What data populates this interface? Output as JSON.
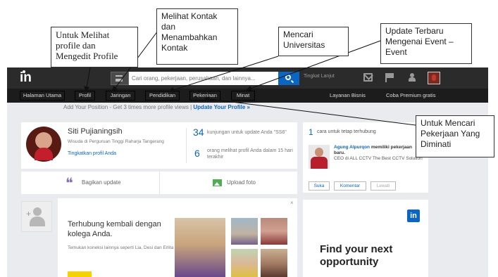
{
  "topbar": {
    "logo": "in",
    "search_placeholder": "Cari orang, pekerjaan, perusahaan, dan lainnya...",
    "advanced_link": "Tingkat Lanjut",
    "icons": [
      "search-icon",
      "mail-icon",
      "flag-icon",
      "add-connection-icon",
      "avatar"
    ]
  },
  "nav": {
    "items": [
      "Halaman Utama",
      "Profil",
      "Jaringan",
      "Pendidikan",
      "Pekerjaan",
      "Minat"
    ],
    "right_items": [
      "Layanan Bisnis",
      "Coba Premium gratis"
    ]
  },
  "promo": {
    "text": "Add Your Position - Get 3 times more profile views | ",
    "link": "Update Your Profile »"
  },
  "profile": {
    "name": "Siti Pujianingsih",
    "subtitle": "Wisuda di Perguruan Tinggi Raharja Tangerang",
    "improve_link": "Tingkatkan profil Anda",
    "stat1_num": "34",
    "stat1_text": "kunjungan untuk update Anda \"SS6\"",
    "stat2_num": "6",
    "stat2_text": "orang melihat profil Anda dalam 15 hari terakhir"
  },
  "share": {
    "update_label": "Bagikan update",
    "photo_label": "Upload foto"
  },
  "reconnect": {
    "title": "Terhubung kembali dengan kolega Anda.",
    "subtitle": "Temukan koneksi lainnya seperti Lia, Desi dan Erlita",
    "close": "×"
  },
  "side": {
    "count": "1",
    "title": "cara untuk tetap terhubung",
    "person": "Agung Alpurqon",
    "action": "memiliki pekerjaan baru.",
    "detail": "CEO di ALL CCTV The Best CCTV Solution",
    "buttons": [
      "Suka",
      "Komentar",
      "Lewati"
    ]
  },
  "ad": {
    "badge": "in",
    "title": "Find your next opportunity"
  },
  "callouts": {
    "profile": "Untuk Melihat\nprofile dan\nMengedit Profile",
    "contacts": "Melihat Kontak\ndan\nMenambahkan\nKontak",
    "universities": "Mencari\nUniversitas",
    "events": "Update Terbaru\nMengenai Event –\nEvent",
    "jobs": "Untuk Mencari\nPekerjaan Yang\nDiminati"
  },
  "colors": {
    "topbar": "#2b2b2b",
    "navbar": "#1c1c1c",
    "accent": "#0a66c2",
    "background": "#e9ebee"
  }
}
